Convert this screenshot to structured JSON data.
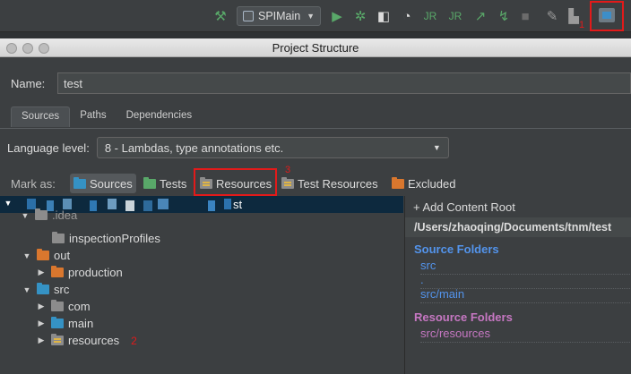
{
  "toolbar": {
    "run_config": "SPIMain",
    "annotation_1": "1",
    "icons": [
      "hammer-icon",
      "run-icon",
      "debug-icon",
      "coverage-icon",
      "profile-icon",
      "jrebel-run-icon",
      "jrebel-debug-icon",
      "attach-icon",
      "stop-icon",
      "vcs-update-icon",
      "vcs-commit-icon",
      "project-structure-icon"
    ]
  },
  "dialog": {
    "title": "Project Structure",
    "name_label": "Name:",
    "name_value": "test",
    "tabs": [
      "Sources",
      "Paths",
      "Dependencies"
    ],
    "active_tab": "Sources",
    "language_label": "Language level:",
    "language_value": "8 - Lambdas, type annotations etc.",
    "mark_as_label": "Mark as:",
    "mark_buttons": {
      "sources": "Sources",
      "tests": "Tests",
      "resources": "Resources",
      "test_resources": "Test Resources",
      "excluded": "Excluded"
    },
    "annotation_3": "3"
  },
  "tree": {
    "root_suffix": "st",
    "idea_label": ".idea",
    "items": {
      "inspection": "inspectionProfiles",
      "out": "out",
      "production": "production",
      "src": "src",
      "com": "com",
      "main": "main",
      "resources": "resources"
    },
    "annotation_2": "2"
  },
  "right_panel": {
    "add_content_root": "+ Add Content Root",
    "path": "/Users/zhaoqing/Documents/tnm/test",
    "source_title": "Source Folders",
    "source_items": [
      "src",
      ".",
      "src/main"
    ],
    "resource_title": "Resource Folders",
    "resource_items": [
      "src/resources"
    ]
  },
  "colors": {
    "accent_red": "#e21a1a",
    "source_blue": "#5394ec",
    "resource_purple": "#c677c2",
    "selection": "#0d293e"
  }
}
